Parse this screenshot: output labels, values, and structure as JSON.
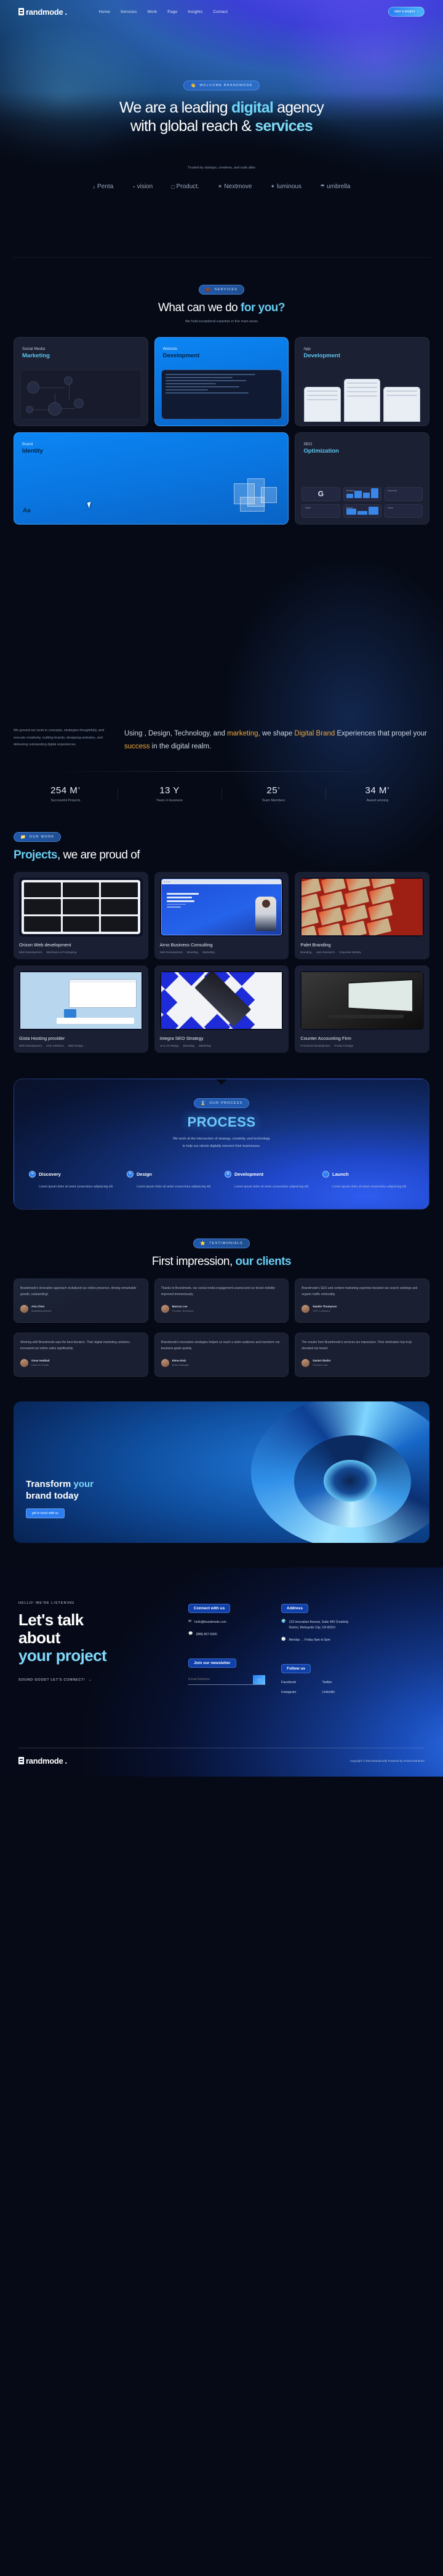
{
  "brand": {
    "name": "randmode",
    "full": "Brandmode.",
    "accent": "#67cdf2",
    "blue": "#0b86f5",
    "gold": "#f0a83a"
  },
  "nav": {
    "links": [
      {
        "label": "Home"
      },
      {
        "label": "Services"
      },
      {
        "label": "Work"
      },
      {
        "label": "Page"
      },
      {
        "label": "Insights"
      },
      {
        "label": "Contact"
      }
    ],
    "cta": "start a project",
    "cta_icon": "chevron-right-icon"
  },
  "hero": {
    "badge": {
      "emoji": "👋",
      "label": "WELCOME BRANDMODE"
    },
    "h1_line1_a": "We are a leading ",
    "h1_line1_b": "digital",
    "h1_line1_c": " agency",
    "h1_line2_a": "with global reach & ",
    "h1_line2_b": "services",
    "trusted": "Trusted by startups, creatives, and suits alike",
    "logos": [
      {
        "glyph": "♪",
        "label": "Penta"
      },
      {
        "glyph": "◔",
        "label": "vision"
      },
      {
        "glyph": "□",
        "label": "Product."
      },
      {
        "glyph": "✶",
        "label": "Nextmove"
      },
      {
        "glyph": "✦",
        "label": "luminous"
      },
      {
        "glyph": "☂",
        "label": "umbrella"
      }
    ]
  },
  "services": {
    "badge": {
      "emoji": "💼",
      "label": "SERVICES"
    },
    "h2_a": "What can we do ",
    "h2_b": "for you?",
    "sub": "We hold exceptional expertise in five  main areas",
    "cards": [
      {
        "kicker": "Social Media",
        "title": "Marketing",
        "style": "dark",
        "art": "network-diagram"
      },
      {
        "kicker": "Website",
        "title": "Development",
        "style": "blue",
        "art": "code-card"
      },
      {
        "kicker": "App",
        "title": "Development",
        "style": "dark",
        "art": "phone-mockups"
      },
      {
        "kicker": "Brand",
        "title": "Identity",
        "style": "blue",
        "art": "brand-blocks"
      },
      {
        "kicker": "SEO",
        "title": "Optimization",
        "style": "dark",
        "art": "seo-widgets"
      }
    ],
    "brand_letters": "Aa",
    "seo_widget_labels": [
      "Google",
      "Ranking",
      "Keywords",
      "Traffic",
      "Report",
      "Score"
    ],
    "seo_google_glyph": "G"
  },
  "about": {
    "small": "We ground our work in concepts, strategize thoughtfully, and execute creatively, crafting brands, designing websites, and delivering outstanding digital experiences.",
    "big_segments": [
      {
        "text": "Using , Design, Technology, and ",
        "bold": false
      },
      {
        "text": "marketing",
        "bold": true
      },
      {
        "text": ", we shape ",
        "bold": false
      },
      {
        "text": "Digital Brand",
        "bold": true
      },
      {
        "text": " Experiences that propel your ",
        "bold": false
      },
      {
        "text": "success",
        "bold": true
      },
      {
        "text": " in the digital realm.",
        "bold": false
      }
    ],
    "stats": [
      {
        "value": "254 M",
        "sup": "+",
        "label": "Successful Projects"
      },
      {
        "value": "13 Y",
        "sup": "",
        "label": "Years in business"
      },
      {
        "value": "25",
        "sup": "+",
        "label": "Team Members"
      },
      {
        "value": "34 M",
        "sup": "+",
        "label": "Award winning"
      }
    ]
  },
  "projects": {
    "badge": {
      "emoji": "📁",
      "label": "OUR WORK"
    },
    "h2_a": "Projects",
    "h2_b": ", we are proud of",
    "items": [
      {
        "title": "Orizon Web development",
        "tags": [
          "Web Development,",
          "Wireframe & Prototyping"
        ],
        "thumb": "grid9"
      },
      {
        "title": "Arno Business Consulting",
        "tags": [
          "Web Development,",
          "Branding,",
          "Marketing"
        ],
        "thumb": "browser",
        "inner": {
          "headline": "Strategic consulting to accelerate growth",
          "cta": "Contact",
          "stats": [
            "50+",
            "1,500+",
            "97 k",
            "345+"
          ]
        }
      },
      {
        "title": "Palet Branding",
        "tags": [
          "Branding,",
          "User Research,",
          "Corporate Identity"
        ],
        "thumb": "redgrid"
      },
      {
        "title": "Gista Hosting provider",
        "tags": [
          "Web Development,",
          "User Interface,",
          "Web Design"
        ],
        "thumb": "hosting"
      },
      {
        "title": "integra SEO Strategy",
        "tags": [
          "UI & UX design,",
          "Branding,",
          "Marketing"
        ],
        "thumb": "bluediamonds"
      },
      {
        "title": "Counter Accounting Firm",
        "tags": [
          "Front-End Development,",
          "Product Design"
        ],
        "thumb": "darkmonitor"
      }
    ]
  },
  "process": {
    "badge": {
      "emoji": "⌛",
      "label": "OUR PROCESS"
    },
    "title": "PROCESS",
    "sub_line1": "We work at the intersection of strategy, creativity, and technology",
    "sub_line2": "to help our clients digitally reinvent their businesses.",
    "steps": [
      {
        "icon": "compass-icon",
        "glyph": "✶",
        "title": "Discovery",
        "text": "Lorem ipsum dolor sit amet consectetur adipisicing elit"
      },
      {
        "icon": "pencil-icon",
        "glyph": "✎",
        "title": "Design",
        "text": "Lorem ipsum dolor sit amet consectetur adipisicing elit"
      },
      {
        "icon": "gear-icon",
        "glyph": "⚙",
        "title": "Development",
        "text": "Lorem ipsum dolor sit amet consectetur adipisicing elit"
      },
      {
        "icon": "rocket-icon",
        "glyph": "∷",
        "title": "Launch",
        "text": "Lorem ipsum dolor sit amet consectetur adipisicing elit"
      }
    ]
  },
  "testimonials": {
    "badge": {
      "emoji": "⭐",
      "label": "TESTIMONIALS"
    },
    "h2_a": "First impression, ",
    "h2_b": "our clients",
    "items": [
      {
        "quote": "Brandmode's innovative approach revitalized our online presence, driving remarkable growth, outstanding!",
        "name": "Aria Chen",
        "role": "Marketing Director",
        "highlight": true
      },
      {
        "quote": "Thanks to Brandmode, our social media engagement soared and our brand visibility improved tremendously.",
        "name": "Marcus Lee",
        "role": "Founder, Nextmove",
        "highlight": false
      },
      {
        "quote": "Brandmode's SEO and content marketing expertise boosted our search rankings and organic traffic noticeably.",
        "name": "Natalie Thompson",
        "role": "CEO, Luminous",
        "highlight": false
      },
      {
        "quote": "Working with Brandmode was the best decision. Their digital marketing solutions increased our online sales significantly.",
        "name": "Omar Haddad",
        "role": "Head of Growth",
        "highlight": false
      },
      {
        "quote": "Brandmode's innovative strategies helped us reach a wider audience and transform our business goals quickly.",
        "name": "Elena Ruiz",
        "role": "Brand Manager",
        "highlight": false
      },
      {
        "quote": "The results from Brandmode's services are impressive. Their dedication has truly elevated our brand.",
        "name": "Daniel Okafor",
        "role": "Product Lead",
        "highlight": false
      }
    ]
  },
  "banner": {
    "h_line1_a": "Transform ",
    "h_line1_b": "your",
    "h_line2": "brand today",
    "button": "get in touch with us"
  },
  "footer": {
    "kicker": "HELLO! WE'RE LISTENING",
    "h_line1": "Let's talk",
    "h_line2": "about",
    "h_line3": "your project",
    "connect_cta": "SOUND GOOD? LET'S CONNECT!",
    "connect_arrow": "→",
    "connect": {
      "title": "Connect with us",
      "items": [
        {
          "icon": "envelope-icon",
          "glyph": "✉",
          "text": "hello@brandmode.com"
        },
        {
          "icon": "chat-icon",
          "glyph": "💬",
          "text": "(888) 807-5000"
        }
      ]
    },
    "address": {
      "title": "Address",
      "items": [
        {
          "icon": "globe-icon",
          "glyph": "🌍",
          "text": "123 Innovation Avenue, Suite 400 Creativity District, Metropolis City, CA 90210"
        },
        {
          "icon": "clock-icon",
          "glyph": "🕓",
          "text": "Monday → Friday 9am to 5pm"
        }
      ]
    },
    "newsletter": {
      "title": "Join our newsletter",
      "placeholder": "Email Address",
      "value": "",
      "submit_glyph": "→"
    },
    "follow": {
      "title": "Follow us",
      "links": [
        "Facebook",
        "Twitter",
        "Instagram",
        "LinkedIn"
      ]
    },
    "copyright": "Copyright © 2024 Brandmode| Powered by Onlinecontributor"
  }
}
